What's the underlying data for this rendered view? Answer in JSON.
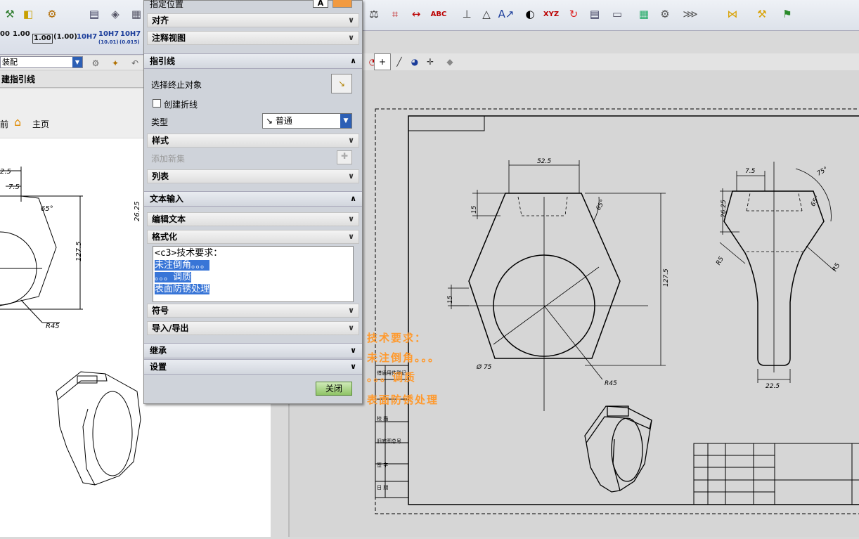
{
  "toolbar_left": {
    "fmt_items": [
      "00",
      "1.00",
      "1.00",
      "(1.00)",
      "10H7",
      "10H7",
      "10H7"
    ],
    "fmt_sub": [
      "(10.01)",
      "(0.015)"
    ]
  },
  "left_panel": {
    "combo_value": "装配",
    "dialog_title": "建指引线",
    "nav_back": "前",
    "nav_home": "主页",
    "dims": {
      "d1": "2.5",
      "d2": "7.5",
      "d3": "127.5",
      "d4": "26.25",
      "d5": "R45",
      "d6": "65°"
    }
  },
  "dialog": {
    "top_item": "指定位置",
    "top_sections": [
      "对齐",
      "注释视图"
    ],
    "leader_header": "指引线",
    "select_end_label": "选择终止对象",
    "create_fold_label": "创建折线",
    "type_label": "类型",
    "type_value": "普通",
    "style_section": "样式",
    "add_set_label": "添加新集",
    "list_section": "列表",
    "text_input_header": "文本输入",
    "edit_text_section": "编辑文本",
    "format_section": "格式化",
    "text_lines": [
      "<c3>技术要求：",
      "未注倒角。。。",
      "。。。调质",
      "表面防锈处理"
    ],
    "symbol_section": "符号",
    "import_export_section": "导入/导出",
    "inherit_header": "继承",
    "settings_header": "设置",
    "close_button": "关闭"
  },
  "drawing": {
    "notes": [
      "技术要求：",
      "未注倒角。。。",
      "。。。调质",
      "表面防锈处理"
    ],
    "dims": {
      "top_width": "52.5",
      "left15": "15",
      "left15b": "15",
      "height": "127.5",
      "diam": "Ø 75",
      "r45": "R45",
      "angle": "65°",
      "side_top": "7.5",
      "side_h": "26.25",
      "side_r1": "R5",
      "side_r2": "R5",
      "side_ang": "75°",
      "side_ang2": "65°",
      "side_bottom": "22.5"
    },
    "side_table": [
      "借通用件登记",
      "旧底图总号",
      "校  描",
      "签  字",
      "日  期"
    ]
  },
  "colors": {
    "accent": "#3875d7",
    "note": "#ff9a2e"
  }
}
